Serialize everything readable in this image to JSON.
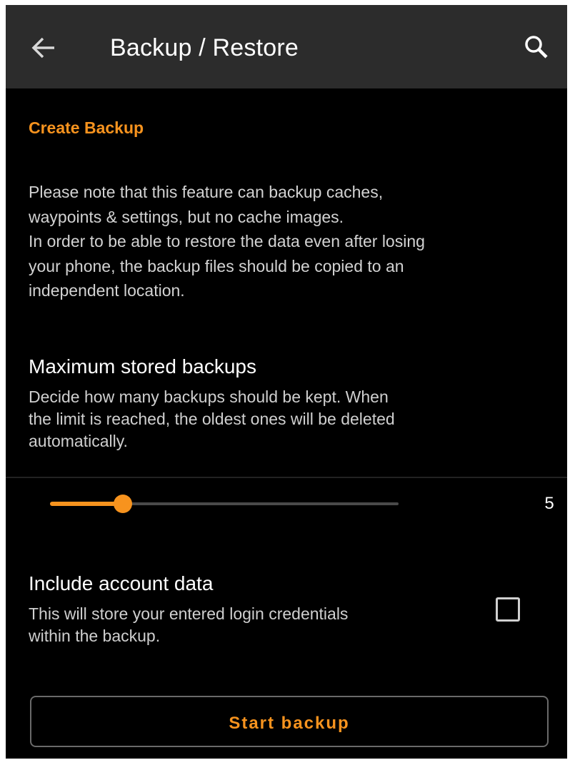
{
  "appbar": {
    "title": "Backup / Restore",
    "back_icon": "arrow-left-icon",
    "search_icon": "search-icon",
    "background": "#2c2c2c"
  },
  "section": {
    "header": "Create Backup",
    "note": "Please note that this feature can backup caches,\nwaypoints & settings, but no cache images.\nIn order to be able to restore the data even after losing\nyour phone, the backup files should be copied to an\nindependent location."
  },
  "max_backups": {
    "title": "Maximum stored backups",
    "summary_lines": [
      "Decide how many backups should be kept. When",
      "the limit is reached, the oldest ones will be deleted",
      "automatically."
    ],
    "slider_fraction": 0.21,
    "value": "5"
  },
  "account_data": {
    "title": "Include account data",
    "summary_lines": [
      "This will store your entered login credentials",
      "within the backup."
    ],
    "checked": false
  },
  "start_button": {
    "label": "Start backup"
  },
  "colors": {
    "accent": "#f7931e",
    "background": "#000000",
    "text_primary": "#ffffff",
    "text_secondary": "#cfcfcf"
  }
}
